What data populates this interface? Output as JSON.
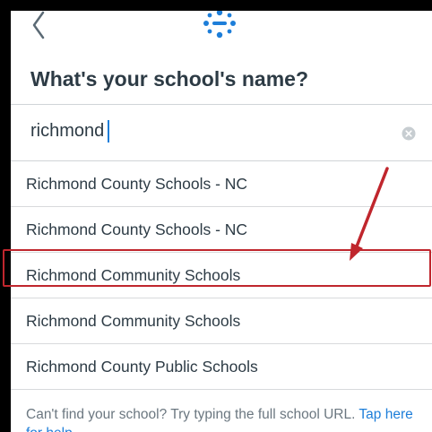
{
  "header": {
    "back_icon": "chevron-left-icon",
    "logo_icon": "canvas-logo-icon"
  },
  "title": "What's your school's name?",
  "search": {
    "value": "richmond",
    "clear_icon": "clear-x-icon"
  },
  "results": [
    {
      "label": "Richmond County Schools - NC"
    },
    {
      "label": "Richmond County Schools - NC"
    },
    {
      "label": "Richmond Community Schools"
    },
    {
      "label": "Richmond Community Schools"
    },
    {
      "label": "Richmond County Public Schools"
    }
  ],
  "footer": {
    "text": "Can't find your school? Try typing the full school URL. ",
    "link": "Tap here for help"
  },
  "colors": {
    "accent": "#1d7ed9",
    "annotation": "#c0262d",
    "text": "#2d3b45"
  }
}
